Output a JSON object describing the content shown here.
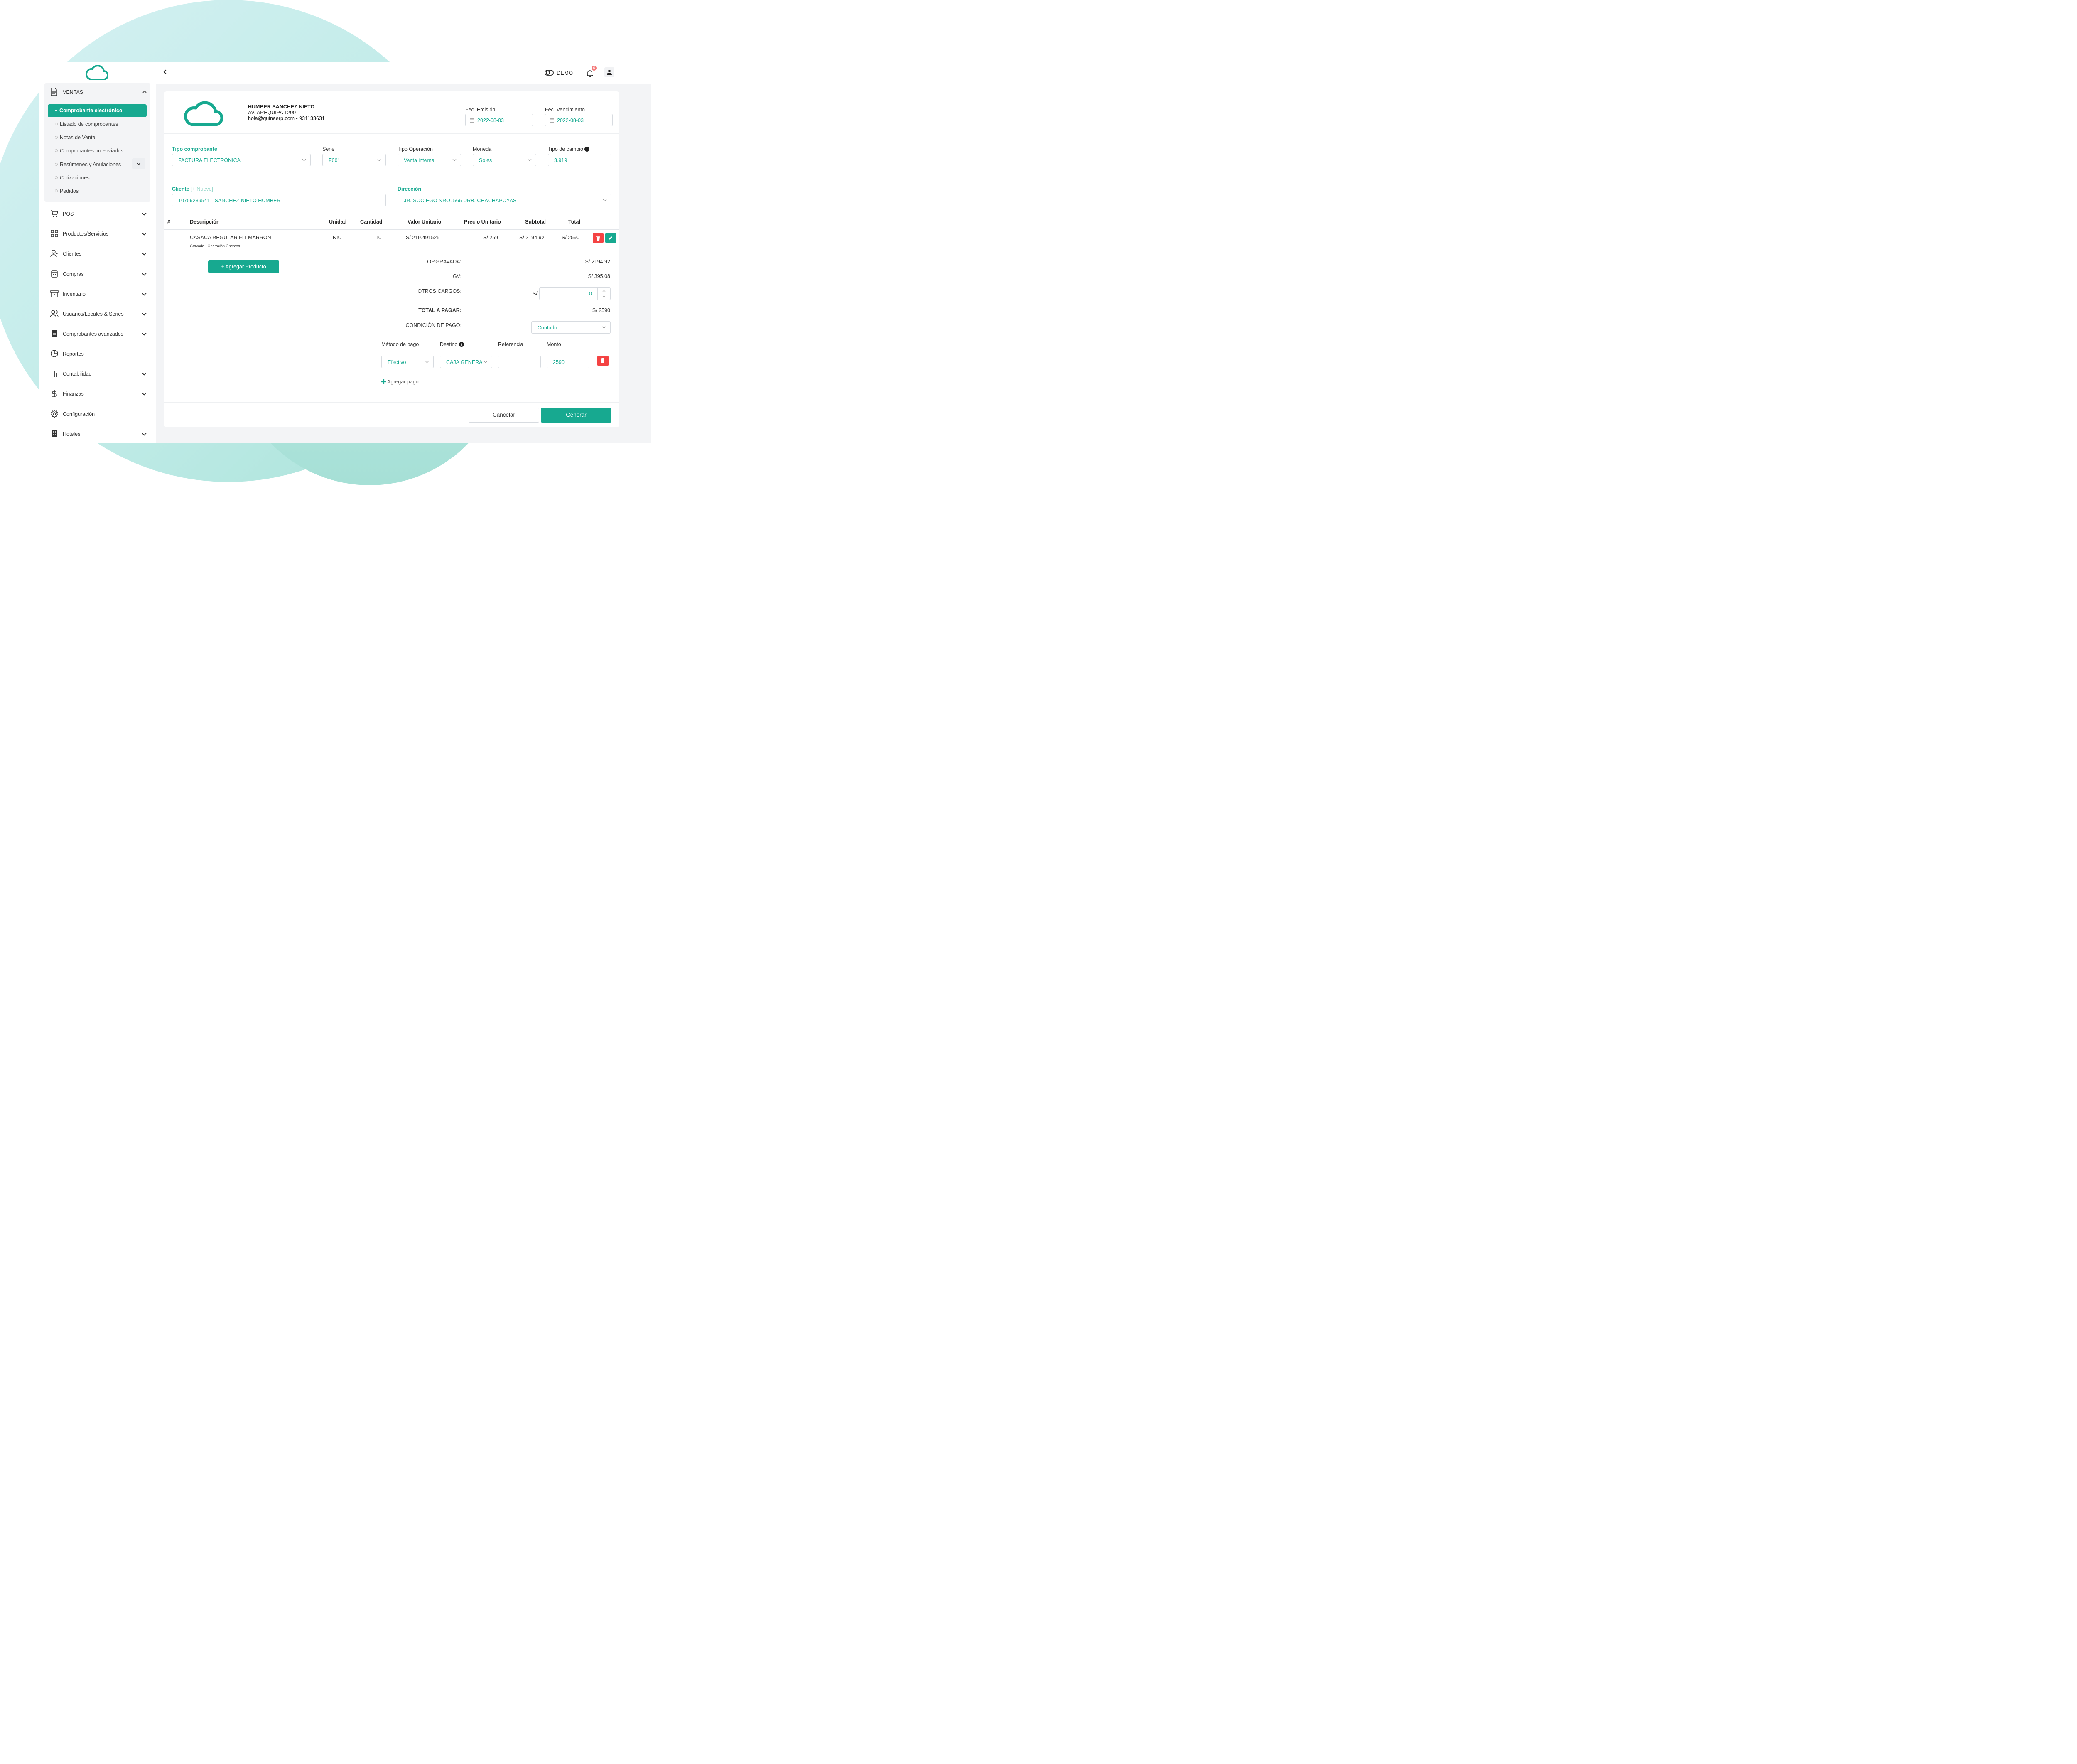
{
  "colors": {
    "accent": "#17a990",
    "danger": "#f44343",
    "notification": "#f47b7b"
  },
  "sidebar": {
    "ventas_label": "VENTAS",
    "sub_items": [
      "Comprobante electrónico",
      "Listado de comprobantes",
      "Notas de Venta",
      "Comprobantes no enviados",
      "Resúmenes y Anulaciones",
      "Cotizaciones",
      "Pedidos"
    ],
    "menu": [
      {
        "label": "POS",
        "icon": "cart-icon"
      },
      {
        "label": "Productos/Servicios",
        "icon": "grid-icon"
      },
      {
        "label": "Clientes",
        "icon": "user-check-icon"
      },
      {
        "label": "Compras",
        "icon": "shopping-bag-icon"
      },
      {
        "label": "Inventario",
        "icon": "archive-icon"
      },
      {
        "label": "Usuarios/Locales & Series",
        "icon": "users-icon"
      },
      {
        "label": "Comprobantes avanzados",
        "icon": "receipt-icon"
      },
      {
        "label": "Reportes",
        "icon": "pie-chart-icon"
      },
      {
        "label": "Contabilidad",
        "icon": "bar-chart-icon"
      },
      {
        "label": "Finanzas",
        "icon": "dollar-icon"
      },
      {
        "label": "Configuración",
        "icon": "gear-icon"
      },
      {
        "label": "Hoteles",
        "icon": "building-icon"
      }
    ]
  },
  "topbar": {
    "mode_label": "DEMO",
    "notification_count": "6"
  },
  "company": {
    "name": "HUMBER SANCHEZ NIETO",
    "address": "AV. AREQUIPA 1200",
    "contact": "hola@quinaerp.com - 931133631"
  },
  "dates": {
    "emision_label": "Fec. Emisión",
    "emision_value": "2022-08-03",
    "vencimiento_label": "Fec. Vencimiento",
    "vencimiento_value": "2022-08-03"
  },
  "form": {
    "tipo_comprobante_label": "Tipo comprobante",
    "tipo_comprobante_value": "FACTURA ELECTRÓNICA",
    "serie_label": "Serie",
    "serie_value": "F001",
    "tipo_operacion_label": "Tipo Operación",
    "tipo_operacion_value": "Venta interna",
    "moneda_label": "Moneda",
    "moneda_value": "Soles",
    "tipo_cambio_label": "Tipo de cambio",
    "tipo_cambio_value": "3.919",
    "cliente_label": "Cliente",
    "cliente_nuevo": "[+ Nuevo]",
    "cliente_value": "10756239541 - SANCHEZ NIETO HUMBER",
    "direccion_label": "Dirección",
    "direccion_value": "JR. SOCIEGO NRO. 566 URB. CHACHAPOYAS"
  },
  "table": {
    "headers": [
      "#",
      "Descripción",
      "Unidad",
      "Cantidad",
      "Valor Unitario",
      "Precio Unitario",
      "Subtotal",
      "Total"
    ],
    "row": {
      "num": "1",
      "descripcion": "CASACA REGULAR FIT MARRON",
      "sub_desc": "Gravado - Operación Onerosa",
      "unidad": "NIU",
      "cantidad": "10",
      "valor_unitario": "S/ 219.491525",
      "precio_unitario": "S/ 259",
      "subtotal": "S/ 2194.92",
      "total": "S/ 2590"
    },
    "add_product": "+ Agregar Producto"
  },
  "summary": {
    "op_gravada_label": "OP.GRAVADA:",
    "op_gravada_value": "S/ 2194.92",
    "igv_label": "IGV:",
    "igv_value": "S/ 395.08",
    "otros_cargos_label": "OTROS CARGOS:",
    "otros_currency": "S/",
    "otros_value": "0",
    "total_label": "TOTAL A PAGAR:",
    "total_value": "S/ 2590",
    "condicion_label": "CONDICIÓN DE PAGO:",
    "condicion_value": "Contado"
  },
  "payment": {
    "metodo_label": "Método de pago",
    "destino_label": "Destino",
    "referencia_label": "Referencia",
    "monto_label": "Monto",
    "metodo_value": "Efectivo",
    "destino_value": "CAJA GENERA",
    "referencia_value": "",
    "monto_value": "2590",
    "add_payment": "Agregar pago"
  },
  "footer": {
    "cancel": "Cancelar",
    "generate": "Generar"
  }
}
